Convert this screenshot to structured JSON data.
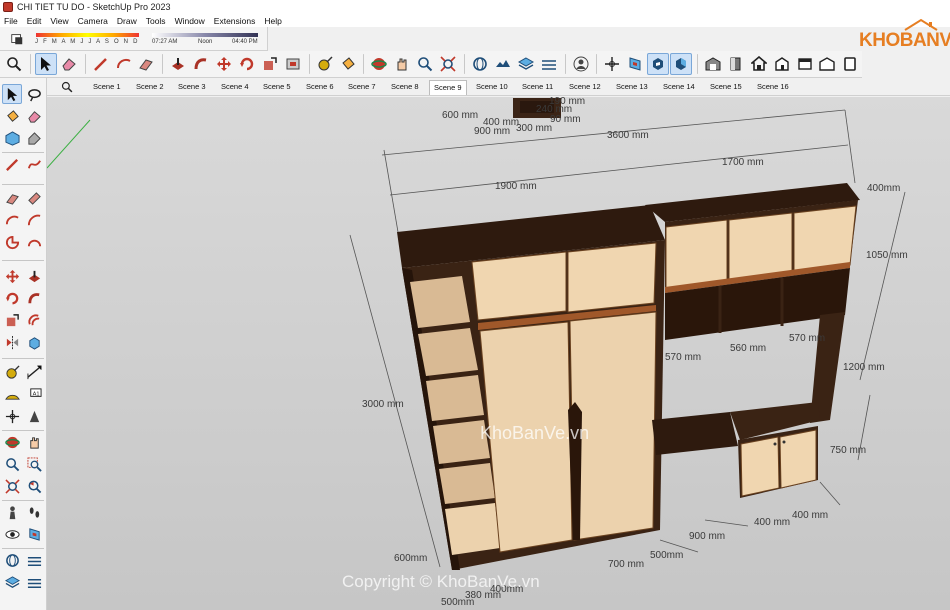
{
  "window": {
    "title": "CHI TIET TU DO - SketchUp Pro 2023"
  },
  "menu": [
    "File",
    "Edit",
    "View",
    "Camera",
    "Draw",
    "Tools",
    "Window",
    "Extensions",
    "Help"
  ],
  "shadows": {
    "months": "J F M A M J J A S O N D",
    "time_start": "07:27 AM",
    "time_mid": "Noon",
    "time_end": "04:40 PM"
  },
  "scenes": [
    "Scene 1",
    "Scene 2",
    "Scene 3",
    "Scene 4",
    "Scene 5",
    "Scene 6",
    "Scene 7",
    "Scene 8",
    "Scene 9",
    "Scene 10",
    "Scene 11",
    "Scene 12",
    "Scene 13",
    "Scene 14",
    "Scene 15",
    "Scene 16"
  ],
  "active_scene": "Scene 9",
  "logo": {
    "text": "KHOBANVE"
  },
  "dimensions": {
    "total_width": "3600 mm",
    "left_width": "1900 mm",
    "right_width": "1700 mm",
    "total_height": "3000 mm",
    "depth_top": "400mm",
    "upper_height": "1050 mm",
    "mid_height": "1200 mm",
    "lower_height": "750 mm",
    "shelf_570a": "570 mm",
    "shelf_560": "560 mm",
    "shelf_570b": "570 mm",
    "desk_900": "900 mm",
    "cab_400a": "400 mm",
    "cab_400b": "400 mm",
    "base_600": "600mm",
    "base_700": "700 mm",
    "base_500a": "500mm",
    "base_500b": "500mm",
    "base_380": "380 mm",
    "base_400": "400mm",
    "top_600": "600 mm",
    "top_900": "900 mm",
    "top_400": "400 mm",
    "top_300": "300 mm",
    "top_240": "240 mm",
    "top_190": "190 mm",
    "top_90": "90 mm"
  },
  "watermark": {
    "center": "KhoBanVe.vn",
    "bottom": "Copyright © KhoBanVe.vn"
  }
}
